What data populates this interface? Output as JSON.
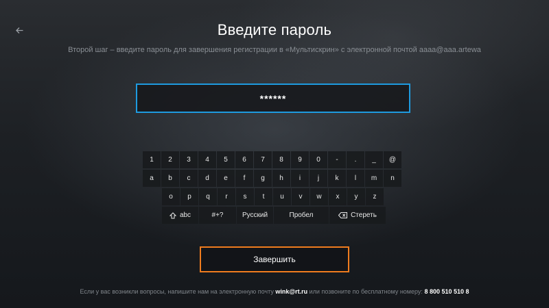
{
  "header": {
    "back_icon": "arrow-left-icon",
    "title": "Введите пароль",
    "subtitle": "Второй шаг – введите пароль для завершения регистрации в «Мультискрин» с электронной почтой aaaa@aaa.artewa"
  },
  "password": {
    "value": "******"
  },
  "keyboard": {
    "row1": [
      "1",
      "2",
      "3",
      "4",
      "5",
      "6",
      "7",
      "8",
      "9",
      "0",
      "-",
      ".",
      "_",
      "@"
    ],
    "row2": [
      "a",
      "b",
      "c",
      "d",
      "e",
      "f",
      "g",
      "h",
      "i",
      "j",
      "k",
      "l",
      "m",
      "n"
    ],
    "row3": [
      "o",
      "p",
      "q",
      "r",
      "s",
      "t",
      "u",
      "v",
      "w",
      "x",
      "y",
      "z"
    ],
    "row4": {
      "shift_icon": "shift-up-icon",
      "abc": "abc",
      "symbols": "#+?",
      "russian": "Русский",
      "space": "Пробел",
      "delete_icon": "backspace-icon",
      "delete": "Стереть"
    }
  },
  "finish_label": "Завершить",
  "footer": {
    "text1": "Если у вас возникли вопросы, напишите нам на электронную почту",
    "email": "wink@rt.ru",
    "text2": "или позвоните по бесплатному номеру:",
    "phone": "8 800 510 510 8"
  },
  "colors": {
    "focus_blue": "#1e9be0",
    "accent_orange": "#f07c1e"
  }
}
